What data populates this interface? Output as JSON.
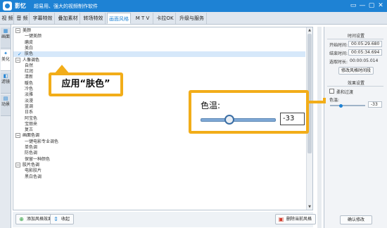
{
  "app": {
    "name": "影忆",
    "slogan": "超易用、强大的视频制作软件",
    "window_buttons": [
      "▭",
      "—",
      "▢",
      "✕"
    ]
  },
  "menu": {
    "tabs": [
      "视 频",
      "音 频",
      "字幕特效",
      "叠加素材",
      "转场特效",
      "画面风格",
      "M T V",
      "卡拉OK",
      "升级与服务"
    ],
    "active": "画面风格"
  },
  "side_tabs": [
    {
      "icon": "▦",
      "label": "画面"
    },
    {
      "icon": "✦",
      "label": "美化"
    },
    {
      "icon": "◧",
      "label": "滤镜"
    },
    {
      "icon": "▤",
      "label": "动景"
    }
  ],
  "list": {
    "rows": [
      {
        "type": "group",
        "label": "美颜"
      },
      {
        "type": "item",
        "label": "一键美颜"
      },
      {
        "type": "item",
        "label": "磨皮"
      },
      {
        "type": "item",
        "label": "美白"
      },
      {
        "type": "item",
        "label": "肤色",
        "selected": true
      },
      {
        "type": "group",
        "label": "人像调色"
      },
      {
        "type": "item",
        "label": "自然"
      },
      {
        "type": "item",
        "label": "红润"
      },
      {
        "type": "item",
        "label": "清新"
      },
      {
        "type": "item",
        "label": "暖色"
      },
      {
        "type": "item",
        "label": "冷色"
      },
      {
        "type": "item",
        "label": "淡雅"
      },
      {
        "type": "item",
        "label": "淡漫"
      },
      {
        "type": "item",
        "label": "蓝调"
      },
      {
        "type": "item",
        "label": "日系"
      },
      {
        "type": "item",
        "label": "阿宝色"
      },
      {
        "type": "item",
        "label": "宝丽来"
      },
      {
        "type": "item",
        "label": "复古"
      },
      {
        "type": "group",
        "label": "画面色调"
      },
      {
        "type": "item",
        "label": "一键电影专业调色"
      },
      {
        "type": "item",
        "label": "单色调"
      },
      {
        "type": "item",
        "label": "防色调"
      },
      {
        "type": "item",
        "label": "保留一种颜色"
      },
      {
        "type": "group",
        "label": "胶片色调"
      },
      {
        "type": "item",
        "label": "电影胶片"
      },
      {
        "type": "item",
        "label": "黑白色调"
      }
    ],
    "selected_check": "✓",
    "expander": "−"
  },
  "bottom": {
    "add_label": "添加风格效果",
    "collapse_label": "收起",
    "delete_label": "删除当前风格"
  },
  "right": {
    "time_section": "时间设置",
    "start_label": "开始时间:",
    "start_value": "00:05:29.680",
    "end_label": "结束时间:",
    "end_value": "00:05:34.694",
    "duration_label": "选取时长:",
    "duration_value": "00:00:05.014",
    "modify_time_btn": "修改风格时间段",
    "effect_section": "效果设置",
    "soft_transition": "柔和过渡",
    "temp_label": "色温:",
    "temp_value": "-33",
    "confirm_btn": "确认修改"
  },
  "callout": {
    "text": "应用“肤色”"
  },
  "zoom": {
    "label": "色温:",
    "value": "-33"
  },
  "colors": {
    "brand": "#1e82d4",
    "callout": "#f2ad19"
  }
}
